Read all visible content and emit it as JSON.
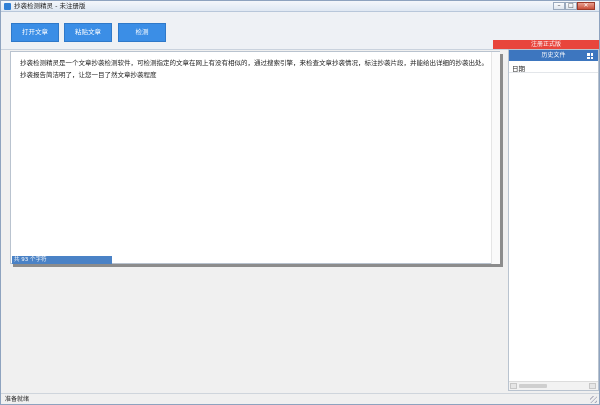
{
  "window": {
    "title": "抄袭检测精灵 - 未注册版",
    "controls": {
      "minimize": "–",
      "maximize": "□",
      "close": "✕"
    }
  },
  "toolbar": {
    "open_label": "打开文章",
    "paste_label": "粘贴文章",
    "detect_label": "检测"
  },
  "register": {
    "label": "注册正式版"
  },
  "editor": {
    "text": "抄袭检测精灵是一个文章抄袭检测软件，可检测指定的文章在网上有没有相似的，通过搜索引擎，来检查文章抄袭情况，标注抄袭片段，并能给出详细的抄袭出处。抄袭报告简洁明了，让您一目了然文章抄袭程度",
    "char_count": "共 93 个字符"
  },
  "history": {
    "title": "历史文件",
    "column_date": "日期"
  },
  "status": {
    "text": "准备就绪"
  },
  "colors": {
    "accent": "#3b8ee6",
    "header": "#3d76bf",
    "register": "#e8453c"
  },
  "icons": [
    "app-icon",
    "grid-icon"
  ]
}
